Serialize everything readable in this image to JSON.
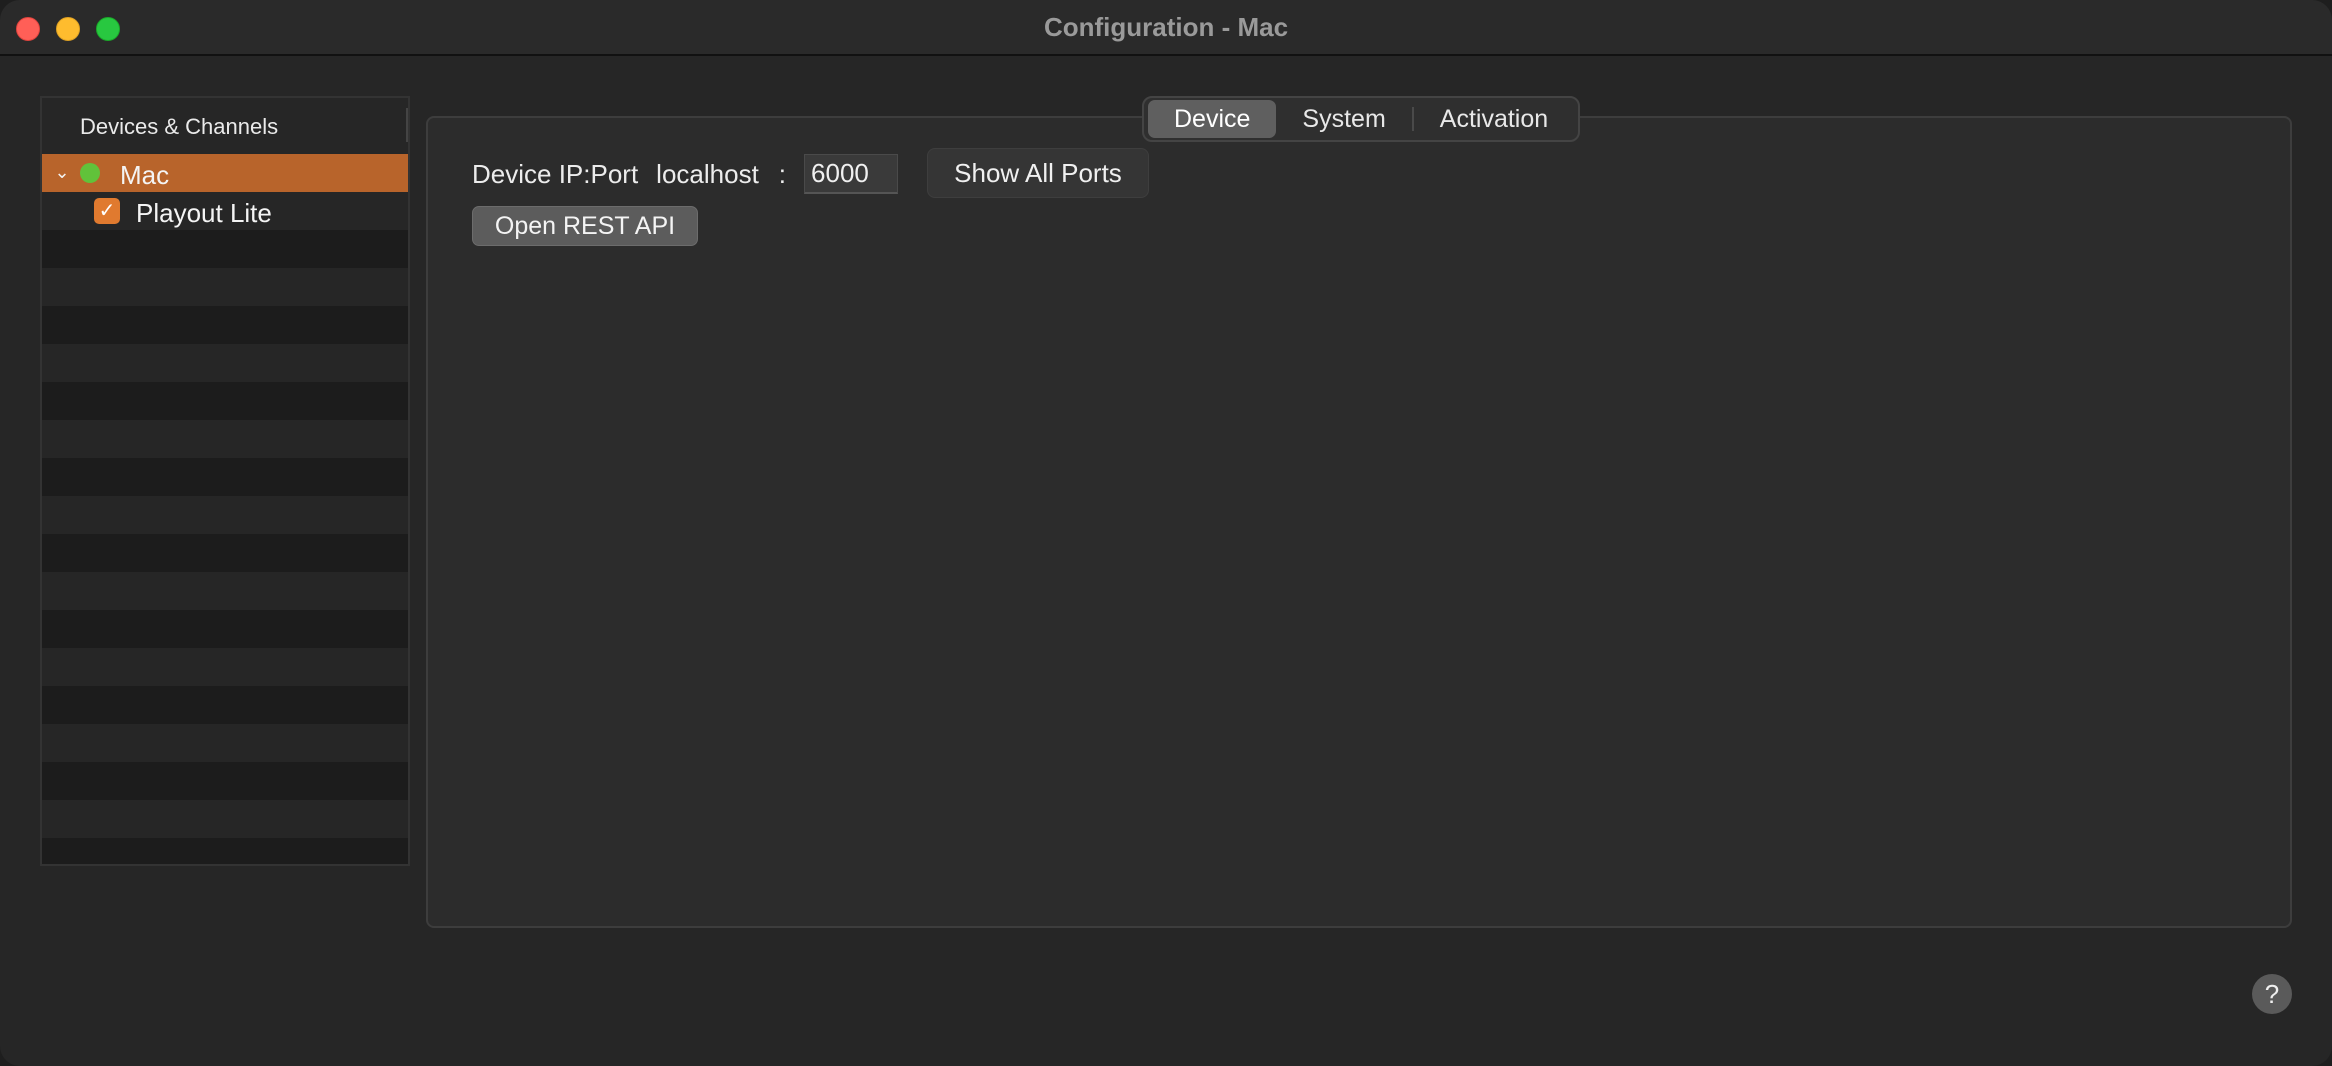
{
  "window": {
    "title": "Configuration - Mac"
  },
  "sidebar": {
    "header": "Devices & Channels",
    "items": [
      {
        "label": "Mac",
        "status": "online",
        "expanded": true,
        "selected": true
      },
      {
        "label": "Playout Lite",
        "checked": true
      }
    ]
  },
  "tabs": [
    {
      "label": "Device",
      "active": true
    },
    {
      "label": "System",
      "active": false
    },
    {
      "label": "Activation",
      "active": false
    }
  ],
  "device": {
    "ip_port_label": "Device IP:Port",
    "host": "localhost",
    "separator": ":",
    "port": "6000",
    "show_all_ports_label": "Show All Ports",
    "open_rest_api_label": "Open REST API"
  },
  "help": {
    "label": "?"
  },
  "colors": {
    "selection": "#b8642b",
    "checkbox": "#e07a2f",
    "status_online": "#61c23a",
    "close": "#ff5f57",
    "minimize": "#febc2e",
    "maximize": "#28c840"
  }
}
